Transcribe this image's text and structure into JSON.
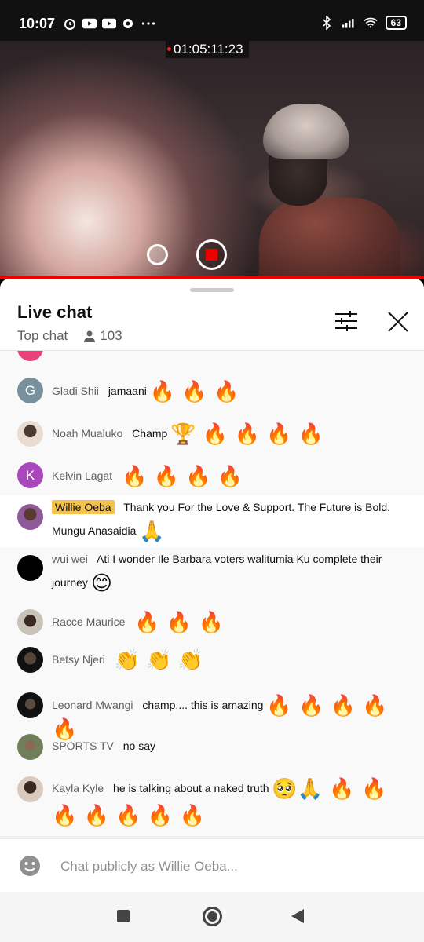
{
  "status_bar": {
    "time": "10:07",
    "battery": "63",
    "left_icons": [
      "alarm-icon",
      "youtube-icon",
      "youtube-icon",
      "notification-icon",
      "more-icon"
    ],
    "right_icons": [
      "bluetooth-icon",
      "signal-icon",
      "wifi-icon",
      "battery-icon"
    ]
  },
  "video": {
    "timer": "01:05:11:23",
    "accent": "#e00000"
  },
  "live_chat": {
    "title": "Live chat",
    "mode": "Top chat",
    "viewer_count": "103"
  },
  "messages": [
    {
      "author": "Gladi Shii",
      "text": "jamaani",
      "emoji": "🔥 🔥 🔥",
      "avatar_letter": "G",
      "avatar_color": "#78909c"
    },
    {
      "author": "Noah Mualuko",
      "text": "Champ",
      "emoji": "🏆 🔥 🔥 🔥 🔥",
      "avatar_letter": "",
      "avatar_color": "#d9c6b8"
    },
    {
      "author": "Kelvin Lagat",
      "text": "",
      "emoji": "🔥 🔥 🔥 🔥",
      "avatar_letter": "K",
      "avatar_color": "#ab47bc"
    },
    {
      "author": "Willie Oeba",
      "text": "Thank you For the Love & Support. The Future is Bold. Mungu Anasaidia",
      "emoji": "🙏",
      "avatar_letter": "",
      "avatar_color": "#8e5a9a",
      "owner": true
    },
    {
      "author": "wui wei",
      "text": "Ati I wonder Ile Barbara voters walitumia Ku complete their journey",
      "emoji": "😊",
      "avatar_letter": "",
      "avatar_color": "#000000"
    },
    {
      "author": "Racce Maurice",
      "text": "",
      "emoji": "🔥 🔥 🔥",
      "avatar_letter": "",
      "avatar_color": "#5d4a3e"
    },
    {
      "author": "Betsy Njeri",
      "text": "",
      "emoji": "👏 👏 👏",
      "avatar_letter": "",
      "avatar_color": "#2b2b2b"
    },
    {
      "author": "Leonard Mwangi",
      "text": "champ.... this is amazing",
      "emoji": "🔥 🔥 🔥 🔥 🔥",
      "avatar_letter": "",
      "avatar_color": "#1a1a1a"
    },
    {
      "author": "SPORTS TV",
      "text": "no say",
      "emoji": "",
      "avatar_letter": "",
      "avatar_color": "#6f7f5a"
    },
    {
      "author": "Kayla Kyle",
      "text": "he is talking about a naked truth",
      "emoji": "🥺🙏 🔥 🔥 🔥 🔥 🔥 🔥 🔥",
      "avatar_letter": "",
      "avatar_color": "#c9b4a0"
    }
  ],
  "input": {
    "placeholder": "Chat publicly as Willie Oeba..."
  }
}
